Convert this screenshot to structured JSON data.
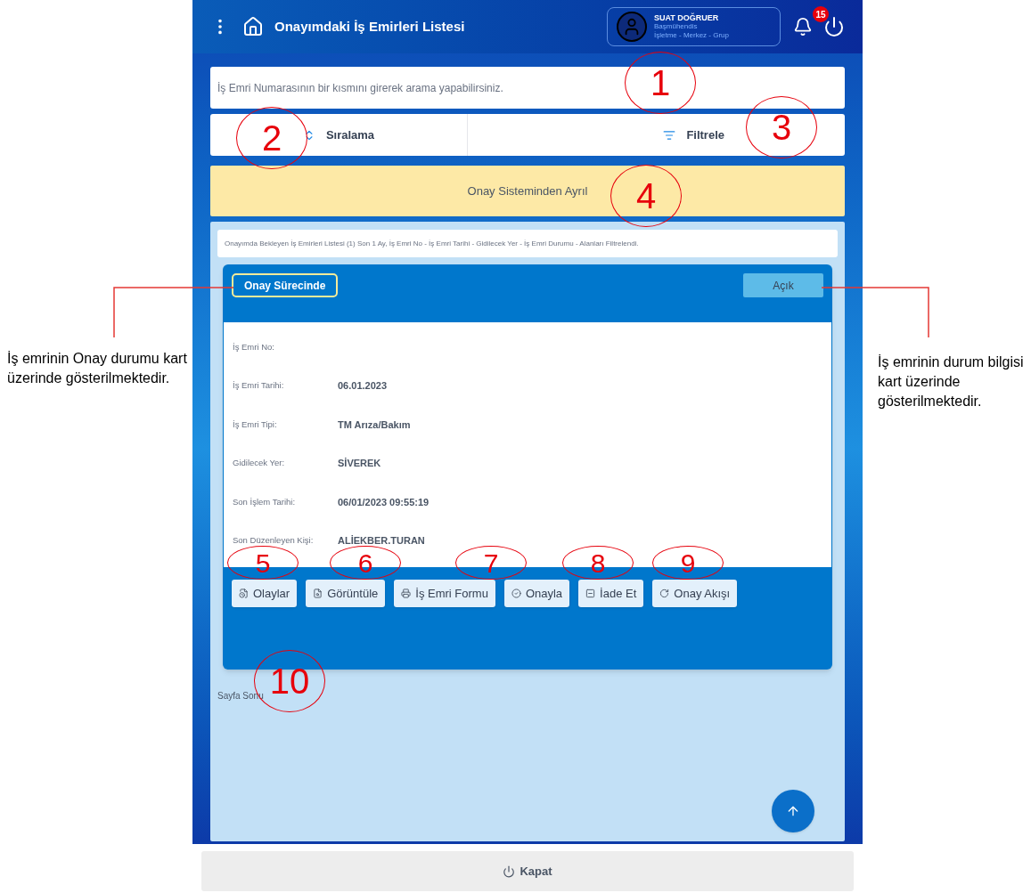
{
  "header": {
    "title": "Onayımdaki İş Emirleri Listesi",
    "user": {
      "name": "SUAT DOĞRUER",
      "role": "Başmühendis",
      "unit": "İşletme - Merkez - Grup"
    },
    "notification_count": "15"
  },
  "search": {
    "placeholder": "İş Emri Numarasının bir kısmını girerek arama yapabilirsiniz."
  },
  "toolbar": [
    {
      "kind": "sort",
      "label": "Sıralama"
    },
    {
      "kind": "filter",
      "label": "Filtrele"
    }
  ],
  "banner": "Onay Sisteminden Ayrıl",
  "list_info": "Onayımda Bekleyen İş Emirleri Listesi (1) Son 1 Ay, İş Emri No - İş Emri Tarihi - Gidilecek Yer - İş Emri Durumu - Alanları Filtrelendi.",
  "card": {
    "approval_status": "Onay Sürecinde",
    "state": "Açık",
    "fields": [
      {
        "label": "İş Emri No:"
      },
      {
        "label": "İş Emri Tarihi:",
        "value": "06.01.2023"
      },
      {
        "label": "İş Emri Tipi:",
        "value": "TM Arıza/Bakım"
      },
      {
        "label": "Gidilecek Yer:",
        "value": "SİVEREK"
      },
      {
        "label": "Son İşlem Tarihi:",
        "value": "06/01/2023 09:55:19"
      },
      {
        "label": "Son Düzenleyen Kişi:",
        "value": "ALİEKBER.TURAN"
      }
    ],
    "actions": [
      {
        "kind": "events",
        "label": "Olaylar"
      },
      {
        "kind": "view",
        "label": "Görüntüle"
      },
      {
        "kind": "form",
        "label": "İş Emri Formu"
      },
      {
        "kind": "approve",
        "label": "Onayla"
      },
      {
        "kind": "return",
        "label": "İade Et"
      },
      {
        "kind": "flow",
        "label": "Onay Akışı"
      }
    ]
  },
  "page_end": "Sayfa Sonu",
  "close_button": "Kapat",
  "annotations": {
    "markers": [
      "1",
      "2",
      "3",
      "4",
      "5",
      "6",
      "7",
      "8",
      "9",
      "10"
    ],
    "left_note": "İş emrinin Onay durumu kart üzerinde gösterilmektedir.",
    "right_note": "İş emrinin durum bilgisi kart üzerinde gösterilmektedir."
  }
}
